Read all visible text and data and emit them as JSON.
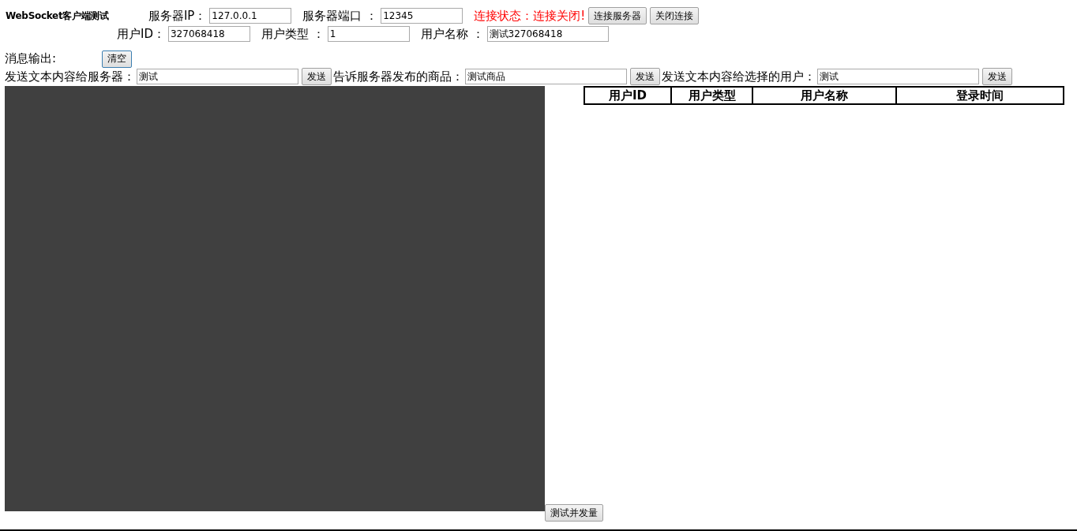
{
  "title": "WebSocket客户端测试",
  "connection": [
    {
      "label": "服务器IP：",
      "value": "127.0.0.1"
    },
    {
      "label": "服务器端口 ：",
      "value": "12345"
    }
  ],
  "status": "连接状态：连接关闭!",
  "connection_buttons": [
    "连接服务器",
    "关闭连接"
  ],
  "user_fields": [
    {
      "label": "用户ID：",
      "value": "327068418"
    },
    {
      "label": "用户类型 ：",
      "value": "1"
    },
    {
      "label": "用户名称 ：",
      "value": "测试327068418"
    }
  ],
  "output": {
    "label": "消息输出:",
    "clear_button": "清空"
  },
  "send_rows": [
    {
      "label": "发送文本内容给服务器：",
      "value": "测试",
      "button": "发送"
    },
    {
      "label": "告诉服务器发布的商品：",
      "value": "测试商品",
      "button": "发送"
    },
    {
      "label": "发送文本内容给选择的用户：",
      "value": "测试",
      "button": "发送"
    }
  ],
  "test_button": "测试并发量",
  "table": {
    "columns": [
      "用户ID",
      "用户类型",
      "用户名称",
      "登录时间"
    ]
  }
}
